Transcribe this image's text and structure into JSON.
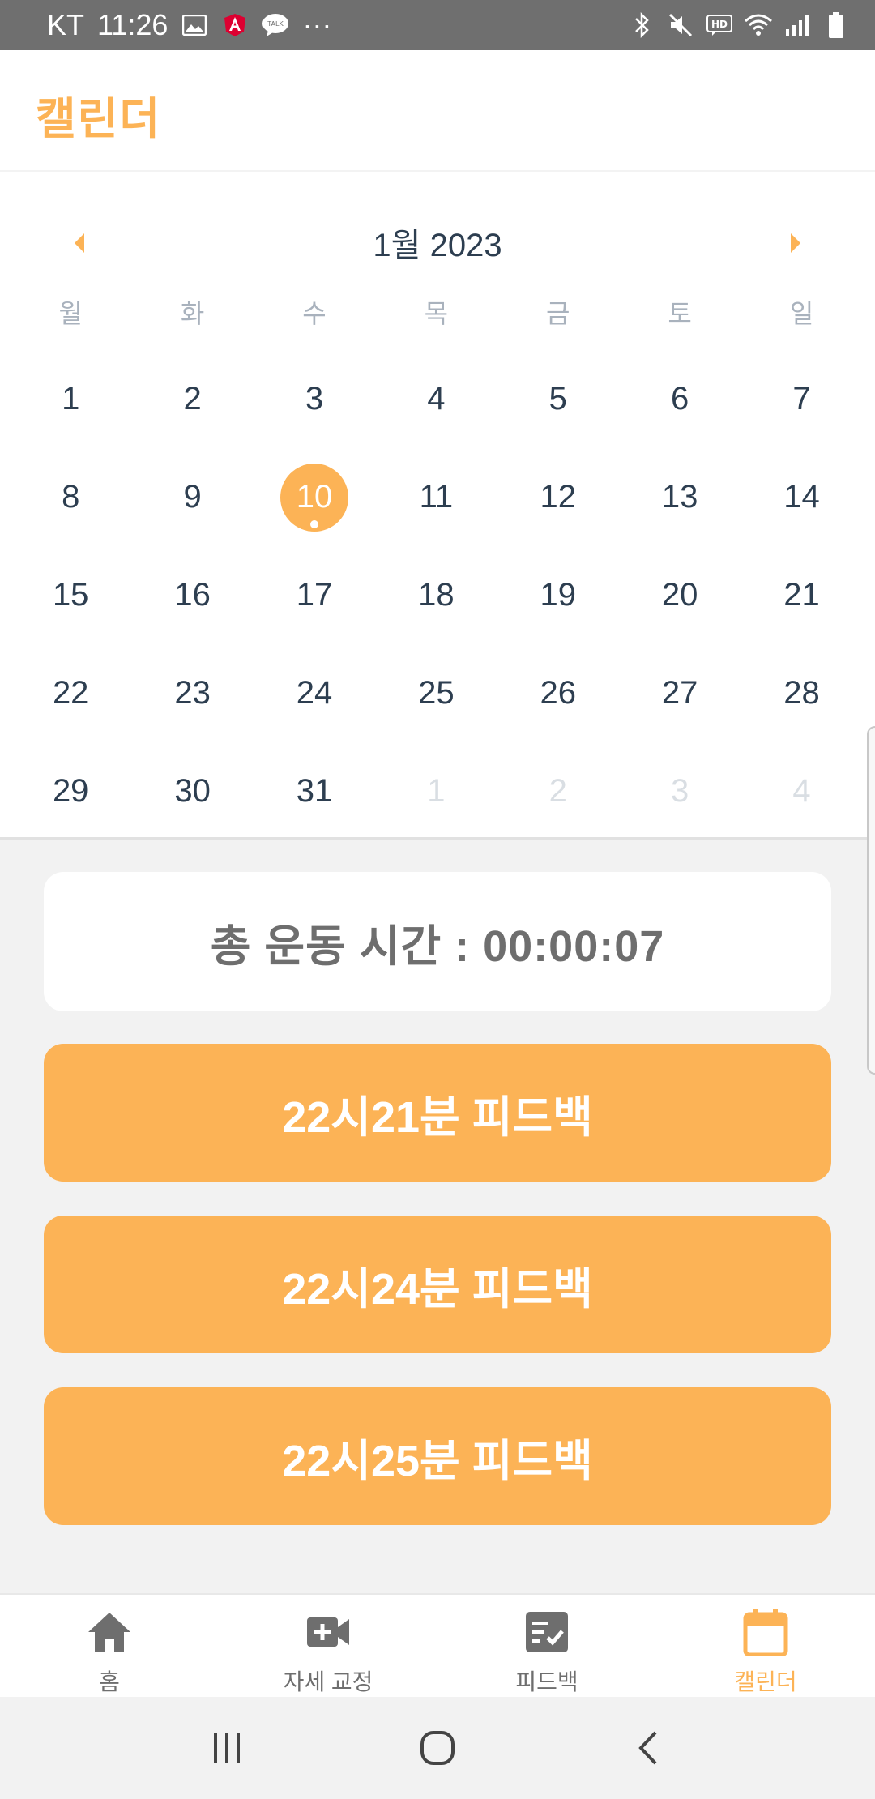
{
  "status_bar": {
    "carrier": "KT",
    "time": "11:26",
    "more": "···"
  },
  "header": {
    "title": "캘린더"
  },
  "calendar": {
    "month_label": "1월 2023",
    "weekdays": [
      "월",
      "화",
      "수",
      "목",
      "금",
      "토",
      "일"
    ],
    "selected_day": "10",
    "weeks": [
      [
        {
          "n": "1"
        },
        {
          "n": "2"
        },
        {
          "n": "3"
        },
        {
          "n": "4"
        },
        {
          "n": "5"
        },
        {
          "n": "6"
        },
        {
          "n": "7"
        }
      ],
      [
        {
          "n": "8"
        },
        {
          "n": "9"
        },
        {
          "n": "10",
          "selected": true,
          "event": true
        },
        {
          "n": "11"
        },
        {
          "n": "12"
        },
        {
          "n": "13"
        },
        {
          "n": "14"
        }
      ],
      [
        {
          "n": "15"
        },
        {
          "n": "16"
        },
        {
          "n": "17"
        },
        {
          "n": "18"
        },
        {
          "n": "19"
        },
        {
          "n": "20"
        },
        {
          "n": "21"
        }
      ],
      [
        {
          "n": "22"
        },
        {
          "n": "23"
        },
        {
          "n": "24"
        },
        {
          "n": "25"
        },
        {
          "n": "26"
        },
        {
          "n": "27"
        },
        {
          "n": "28"
        }
      ],
      [
        {
          "n": "29"
        },
        {
          "n": "30"
        },
        {
          "n": "31"
        },
        {
          "n": "1",
          "muted": true
        },
        {
          "n": "2",
          "muted": true
        },
        {
          "n": "3",
          "muted": true
        },
        {
          "n": "4",
          "muted": true
        }
      ]
    ]
  },
  "summary": {
    "text": "총 운동 시간 : 00:00:07"
  },
  "feedback_items": [
    {
      "label": "22시21분 피드백"
    },
    {
      "label": "22시24분 피드백"
    },
    {
      "label": "22시25분 피드백"
    }
  ],
  "bottom_nav": [
    {
      "label": "홈",
      "icon": "home-icon"
    },
    {
      "label": "자세 교정",
      "icon": "video-plus-icon"
    },
    {
      "label": "피드백",
      "icon": "checklist-icon"
    },
    {
      "label": "캘린더",
      "icon": "calendar-icon",
      "active": true
    }
  ],
  "colors": {
    "accent": "#fcb356",
    "text_dark": "#2d3e50",
    "muted": "#a9b2bd",
    "gray_text": "#6e6e6e"
  }
}
